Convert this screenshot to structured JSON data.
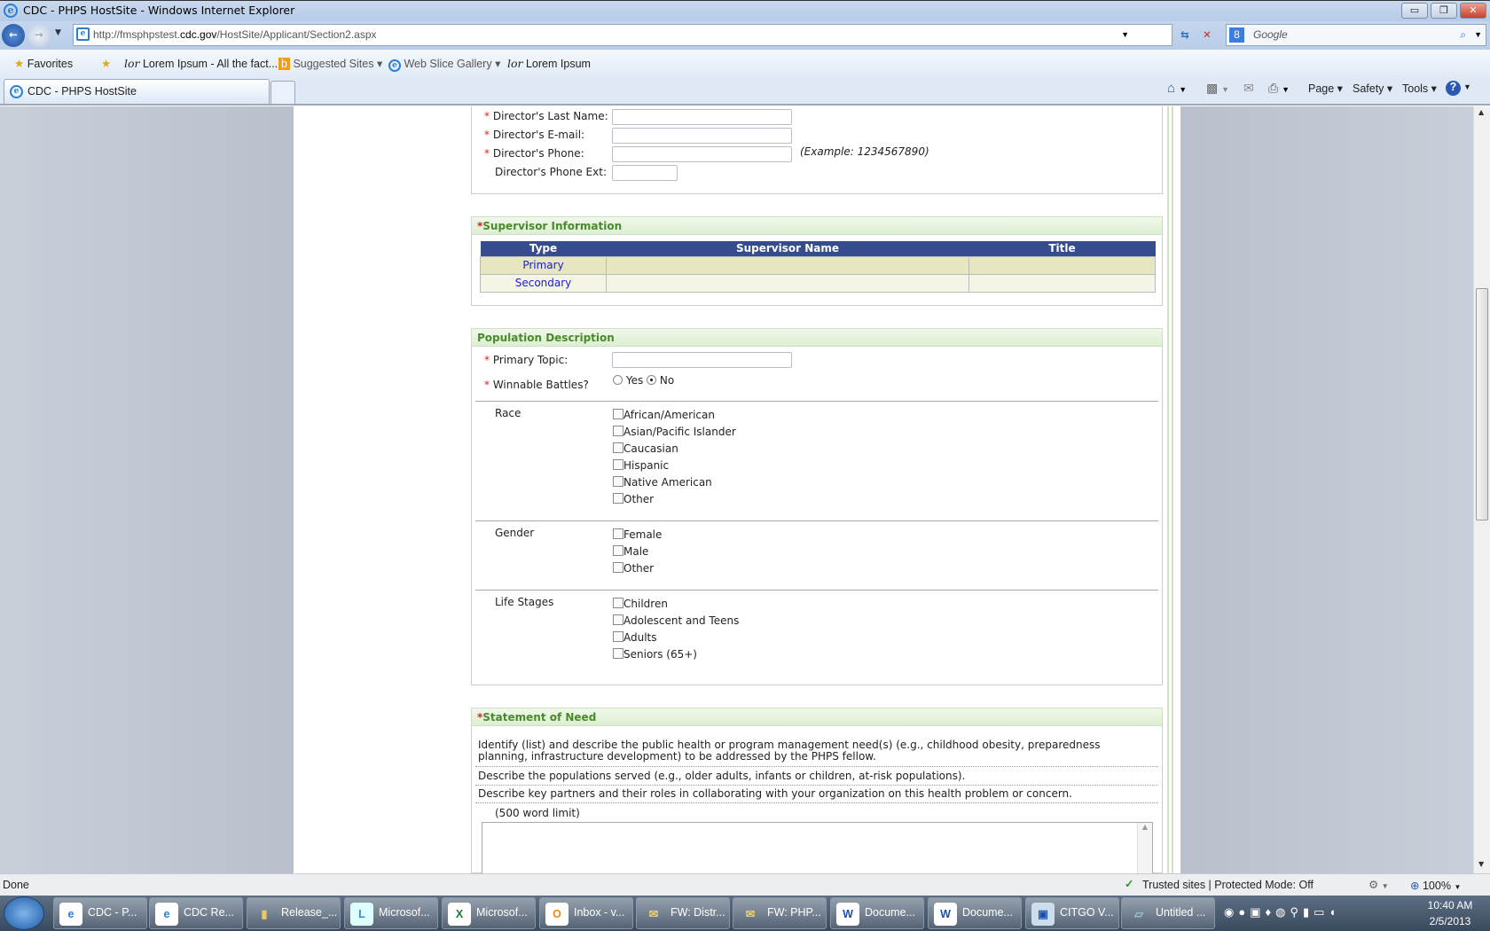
{
  "window": {
    "title": "CDC - PHPS HostSite - Windows Internet Explorer",
    "minimize": "▭",
    "restore": "❐",
    "close": "✕"
  },
  "address": {
    "prefix": "http://fmsphpstest.",
    "domain": "cdc.gov",
    "path": "/HostSite/Applicant/Section2.aspx"
  },
  "search": {
    "placeholder": "Google"
  },
  "favorites": {
    "label": "Favorites",
    "items": [
      {
        "label": "Lorem Ipsum - All the fact..."
      },
      {
        "label": "Suggested Sites ▾"
      },
      {
        "label": "Web Slice Gallery ▾"
      },
      {
        "label": "Lorem Ipsum"
      }
    ]
  },
  "tab": {
    "label": "CDC - PHPS HostSite"
  },
  "commandbar": {
    "page": "Page ▾",
    "safety": "Safety ▾",
    "tools": "Tools ▾"
  },
  "director": {
    "fields": [
      {
        "label": "Director's Last Name:",
        "required": true
      },
      {
        "label": "Director's E-mail:",
        "required": true
      },
      {
        "label": "Director's Phone:",
        "required": true,
        "hint": "(Example: 1234567890)"
      },
      {
        "label": "Director's Phone Ext:",
        "required": false
      }
    ]
  },
  "supervisor": {
    "title": "Supervisor Information",
    "columns": [
      "Type",
      "Supervisor Name",
      "Title"
    ],
    "rows": [
      {
        "type": "Primary",
        "name": "",
        "title": ""
      },
      {
        "type": "Secondary",
        "name": "",
        "title": ""
      }
    ]
  },
  "population": {
    "title": "Population Description",
    "primary_topic_label": "Primary Topic:",
    "winnable_label": "Winnable Battles?",
    "yes": "Yes",
    "no": "No",
    "winnable_value": "No",
    "race_label": "Race",
    "race": [
      "African/American",
      "Asian/Pacific Islander",
      "Caucasian",
      "Hispanic",
      "Native American",
      "Other"
    ],
    "gender_label": "Gender",
    "gender": [
      "Female",
      "Male",
      "Other"
    ],
    "life_label": "Life Stages",
    "life": [
      "Children",
      "Adolescent and Teens",
      "Adults",
      "Seniors (65+)"
    ]
  },
  "need": {
    "title": "Statement of Need",
    "lines": [
      "Identify (list) and describe the public health or program management need(s) (e.g., childhood obesity, preparedness planning, infrastructure development) to be addressed by the PHPS fellow.",
      "Describe the populations served (e.g., older adults, infants or children, at-risk populations).",
      "Describe key partners and their roles in collaborating with your organization on this health problem or concern."
    ],
    "limit": "(500 word limit)"
  },
  "status": {
    "text": "Done",
    "zone": "Trusted sites | Protected Mode: Off",
    "zoom": "100%"
  },
  "taskbar": {
    "items": [
      {
        "label": "CDC - P...",
        "icon": "ie"
      },
      {
        "label": "CDC Re...",
        "icon": "ie"
      },
      {
        "label": "Release_...",
        "icon": "folder"
      },
      {
        "label": "Microsof...",
        "icon": "lync"
      },
      {
        "label": "Microsof...",
        "icon": "excel"
      },
      {
        "label": "Inbox - v...",
        "icon": "outlook"
      },
      {
        "label": "FW: Distr...",
        "icon": "mail"
      },
      {
        "label": "FW: PHP...",
        "icon": "mail"
      },
      {
        "label": "Docume...",
        "icon": "word"
      },
      {
        "label": "Docume...",
        "icon": "word"
      },
      {
        "label": "CITGO V...",
        "icon": "remote"
      },
      {
        "label": "Untitled ...",
        "icon": "paint"
      }
    ],
    "time": "10:40 AM",
    "date": "2/5/2013"
  }
}
